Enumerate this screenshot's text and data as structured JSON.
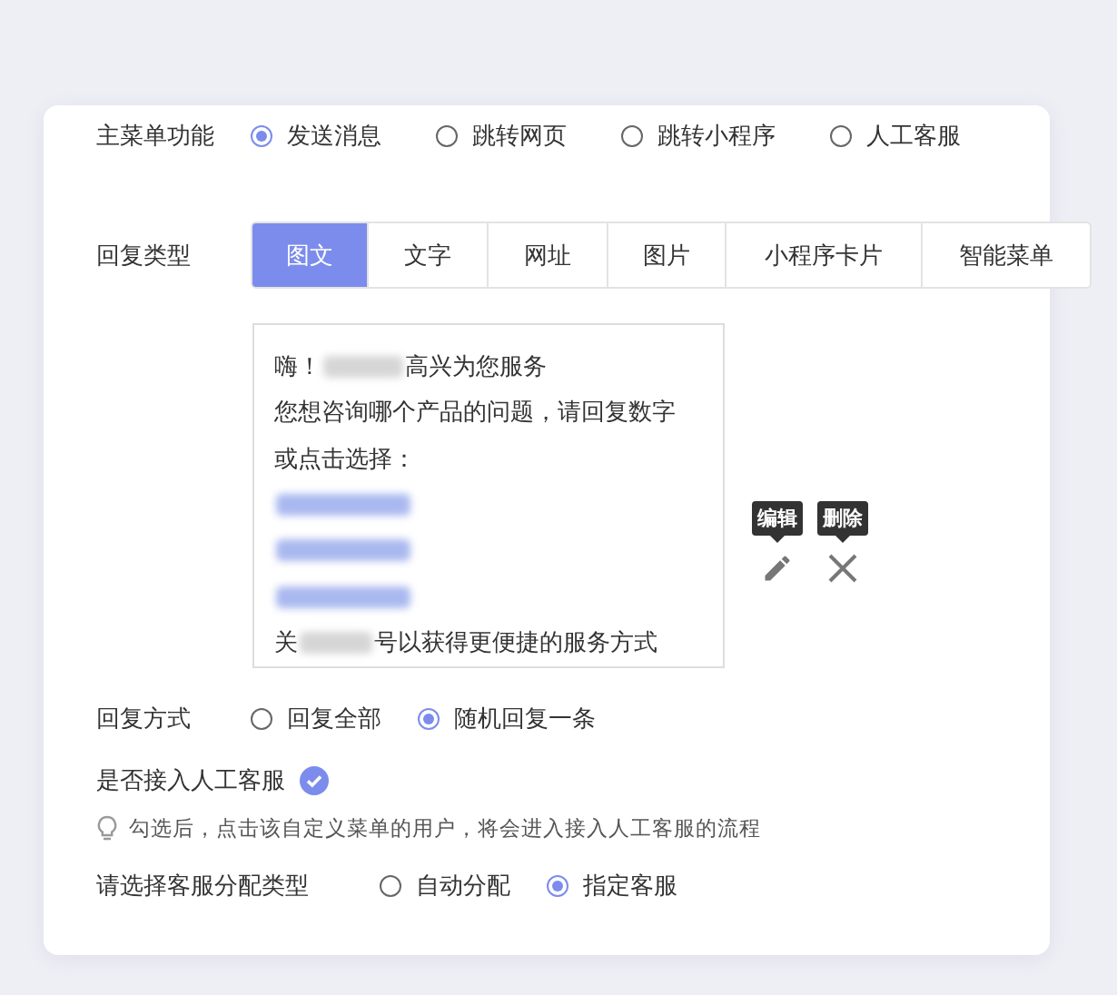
{
  "main_menu": {
    "label": "主菜单功能",
    "options": [
      {
        "label": "发送消息",
        "selected": true
      },
      {
        "label": "跳转网页",
        "selected": false
      },
      {
        "label": "跳转小程序",
        "selected": false
      },
      {
        "label": "人工客服",
        "selected": false
      }
    ]
  },
  "reply_type": {
    "label": "回复类型",
    "tabs": [
      {
        "label": "图文",
        "selected": true
      },
      {
        "label": "文字",
        "selected": false
      },
      {
        "label": "网址",
        "selected": false
      },
      {
        "label": "图片",
        "selected": false
      },
      {
        "label": "小程序卡片",
        "selected": false
      },
      {
        "label": "智能菜单",
        "selected": false
      }
    ]
  },
  "message": {
    "lines": [
      {
        "segments": [
          {
            "kind": "text",
            "text": "嗨！"
          },
          {
            "kind": "blurred"
          },
          {
            "kind": "text",
            "text": "高兴为您服务"
          }
        ]
      },
      {
        "segments": [
          {
            "kind": "text",
            "text": "您想咨询哪个产品的问题，请回复数字"
          }
        ]
      },
      {
        "segments": [
          {
            "kind": "text",
            "text": "或点击选择："
          }
        ]
      },
      {
        "segments": [
          {
            "kind": "blurred_link"
          }
        ]
      },
      {
        "segments": [
          {
            "kind": "blurred_link"
          }
        ]
      },
      {
        "segments": [
          {
            "kind": "blurred_link"
          }
        ]
      },
      {
        "segments": [
          {
            "kind": "text",
            "text": "关"
          },
          {
            "kind": "blurred"
          },
          {
            "kind": "text",
            "text": "号以获得更便捷的服务方式"
          }
        ]
      }
    ]
  },
  "actions": [
    {
      "kind": "edit",
      "tooltip": "编辑"
    },
    {
      "kind": "delete",
      "tooltip": "删除"
    }
  ],
  "reply_mode": {
    "label": "回复方式",
    "options": [
      {
        "label": "回复全部",
        "selected": false
      },
      {
        "label": "随机回复一条",
        "selected": true
      }
    ]
  },
  "handoff": {
    "label": "是否接入人工客服",
    "checked": true,
    "hint": "勾选后，点击该自定义菜单的用户，将会进入接入人工客服的流程"
  },
  "assign": {
    "label": "请选择客服分配类型",
    "options": [
      {
        "label": "自动分配",
        "selected": false
      },
      {
        "label": "指定客服",
        "selected": true
      }
    ]
  }
}
